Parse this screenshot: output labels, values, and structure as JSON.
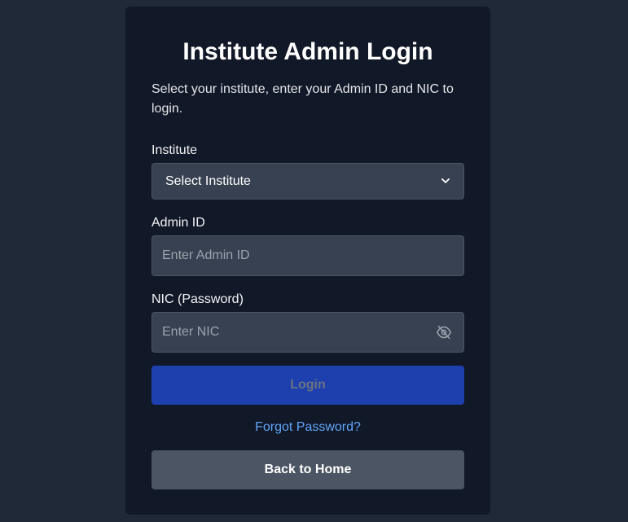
{
  "page": {
    "title": "Institute Admin Login",
    "subtitle": "Select your institute, enter your Admin ID and NIC to login."
  },
  "form": {
    "institute_label": "Institute",
    "institute_selected": "Select Institute",
    "admin_id_label": "Admin ID",
    "admin_id_placeholder": "Enter Admin ID",
    "admin_id_value": "",
    "nic_label": "NIC (Password)",
    "nic_placeholder": "Enter NIC",
    "nic_value": ""
  },
  "actions": {
    "login_label": "Login",
    "forgot_label": "Forgot Password?",
    "home_label": "Back to Home"
  },
  "icons": {
    "password_toggle": "eye-off-icon",
    "select_caret": "chevron-down-icon"
  },
  "colors": {
    "background": "#1f2937",
    "card": "#111827",
    "input": "#374151",
    "primary": "#1e40af",
    "secondary": "#4b5563",
    "link": "#60a5fa"
  }
}
